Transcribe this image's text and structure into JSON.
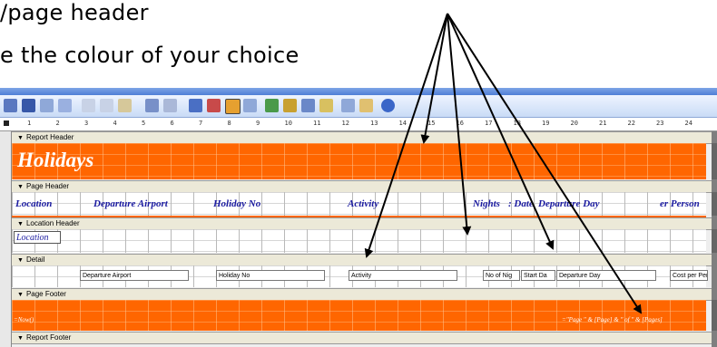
{
  "slide": {
    "line1": "/page header",
    "line2": "e the colour of your choice"
  },
  "ruler": {
    "ticks": [
      "1",
      "2",
      "3",
      "4",
      "5",
      "6",
      "7",
      "8",
      "9",
      "10",
      "11",
      "12",
      "13",
      "14",
      "15",
      "16",
      "17",
      "18",
      "19",
      "20",
      "21",
      "22",
      "23",
      "24"
    ]
  },
  "bands": {
    "report_header": "Report Header",
    "page_header": "Page Header",
    "location_header": "Location Header",
    "detail": "Detail",
    "page_footer": "Page Footer",
    "report_footer": "Report Footer"
  },
  "report_title": "Holidays",
  "page_header_labels": {
    "location": "Location",
    "departure_airport": "Departure Airport",
    "holiday_no": "Holiday No",
    "activity": "Activity",
    "nights": "Nights",
    "date": ": Date",
    "departure_day": "Departure Day",
    "per_person": "er Person"
  },
  "location_field": "Location",
  "detail_fields": {
    "departure_airport": "Departure Airport",
    "holiday_no": "Holiday No",
    "activity": "Activity",
    "no_of_nights": "No of Nig",
    "start_date": "Start Da",
    "departure_day": "Departure Day",
    "cost_per_person": "Cost per Per"
  },
  "footer": {
    "now": "=Now()",
    "page": "=\"Page \" & [Page] & \" of \" & [Pages]"
  },
  "colors": {
    "accent": "#ff6600",
    "label": "#1a1aa0"
  }
}
